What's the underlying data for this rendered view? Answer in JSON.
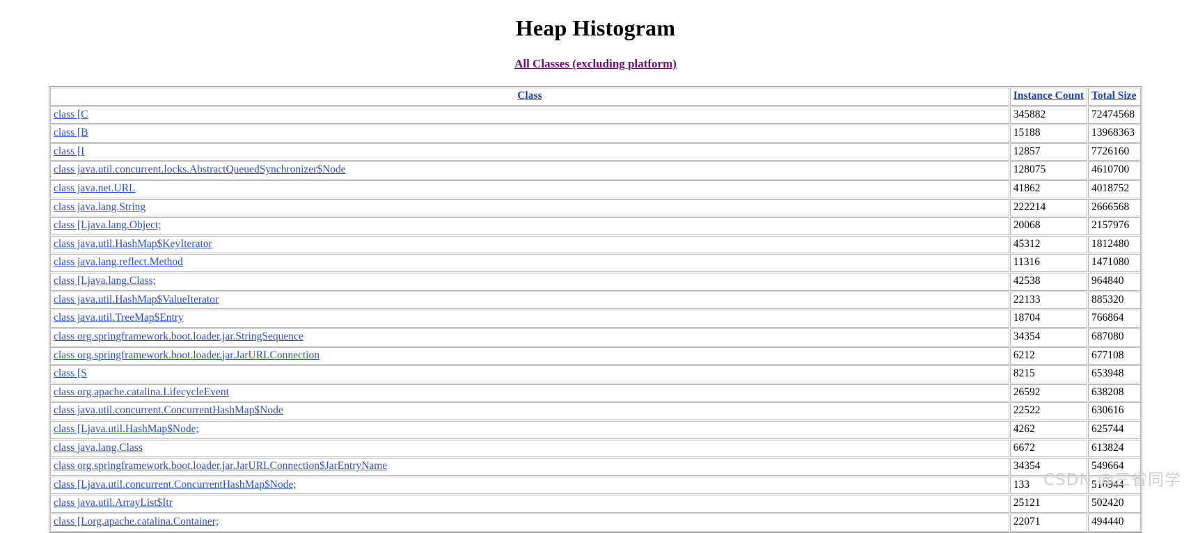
{
  "page": {
    "title": "Heap Histogram"
  },
  "toplink": {
    "label": "All Classes (excluding platform)"
  },
  "table": {
    "headers": {
      "class": "Class",
      "instance_count": "Instance Count",
      "total_size": "Total Size"
    },
    "rows": [
      {
        "class": "class [C",
        "count": "345882",
        "size": "72474568"
      },
      {
        "class": "class [B",
        "count": "15188",
        "size": "13968363"
      },
      {
        "class": "class [I",
        "count": "12857",
        "size": "7726160"
      },
      {
        "class": "class java.util.concurrent.locks.AbstractQueuedSynchronizer$Node",
        "count": "128075",
        "size": "4610700"
      },
      {
        "class": "class java.net.URL",
        "count": "41862",
        "size": "4018752"
      },
      {
        "class": "class java.lang.String",
        "count": "222214",
        "size": "2666568"
      },
      {
        "class": "class [Ljava.lang.Object;",
        "count": "20068",
        "size": "2157976"
      },
      {
        "class": "class java.util.HashMap$KeyIterator",
        "count": "45312",
        "size": "1812480"
      },
      {
        "class": "class java.lang.reflect.Method",
        "count": "11316",
        "size": "1471080"
      },
      {
        "class": "class [Ljava.lang.Class;",
        "count": "42538",
        "size": "964840"
      },
      {
        "class": "class java.util.HashMap$ValueIterator",
        "count": "22133",
        "size": "885320"
      },
      {
        "class": "class java.util.TreeMap$Entry",
        "count": "18704",
        "size": "766864"
      },
      {
        "class": "class org.springframework.boot.loader.jar.StringSequence",
        "count": "34354",
        "size": "687080"
      },
      {
        "class": "class org.springframework.boot.loader.jar.JarURLConnection",
        "count": "6212",
        "size": "677108"
      },
      {
        "class": "class [S",
        "count": "8215",
        "size": "653948"
      },
      {
        "class": "class org.apache.catalina.LifecycleEvent",
        "count": "26592",
        "size": "638208"
      },
      {
        "class": "class java.util.concurrent.ConcurrentHashMap$Node",
        "count": "22522",
        "size": "630616"
      },
      {
        "class": "class [Ljava.util.HashMap$Node;",
        "count": "4262",
        "size": "625744"
      },
      {
        "class": "class java.lang.Class",
        "count": "6672",
        "size": "613824"
      },
      {
        "class": "class org.springframework.boot.loader.jar.JarURLConnection$JarEntryName",
        "count": "34354",
        "size": "549664"
      },
      {
        "class": "class [Ljava.util.concurrent.ConcurrentHashMap$Node;",
        "count": "133",
        "size": "516944"
      },
      {
        "class": "class java.util.ArrayList$Itr",
        "count": "25121",
        "size": "502420"
      },
      {
        "class": "class [Lorg.apache.catalina.Container;",
        "count": "22071",
        "size": "494440"
      }
    ]
  },
  "watermark": {
    "text": "CSDN @三省同学"
  },
  "colors": {
    "link": "#2b4fd4",
    "header_link": "#1a44cf",
    "visited_link": "#6a0e7a",
    "border": "#b9b9b9",
    "watermark": "#cfcfcf"
  }
}
